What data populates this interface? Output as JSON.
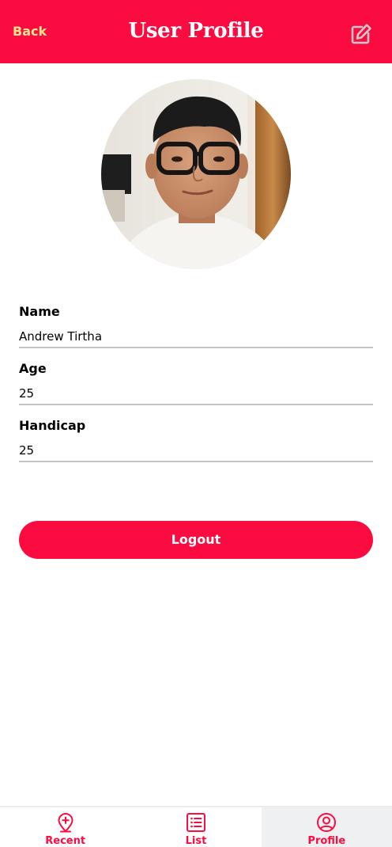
{
  "header": {
    "back_label": "Back",
    "title": "User Profile",
    "edit_icon": "edit-icon"
  },
  "profile": {
    "avatar_icon": "profile-photo",
    "name_label": "Name",
    "name_value": "Andrew Tirtha",
    "age_label": "Age",
    "age_value": "25",
    "handicap_label": "Handicap",
    "handicap_value": "25",
    "logout_label": "Logout"
  },
  "tabs": [
    {
      "label": "Recent",
      "icon": "map-pin-plus-icon"
    },
    {
      "label": "List",
      "icon": "list-icon"
    },
    {
      "label": "Profile",
      "icon": "user-circle-icon",
      "active": true
    }
  ],
  "colors": {
    "accent": "#fb0c40",
    "back_text": "#f2e592",
    "active_tab_bg": "#eef0f2"
  }
}
